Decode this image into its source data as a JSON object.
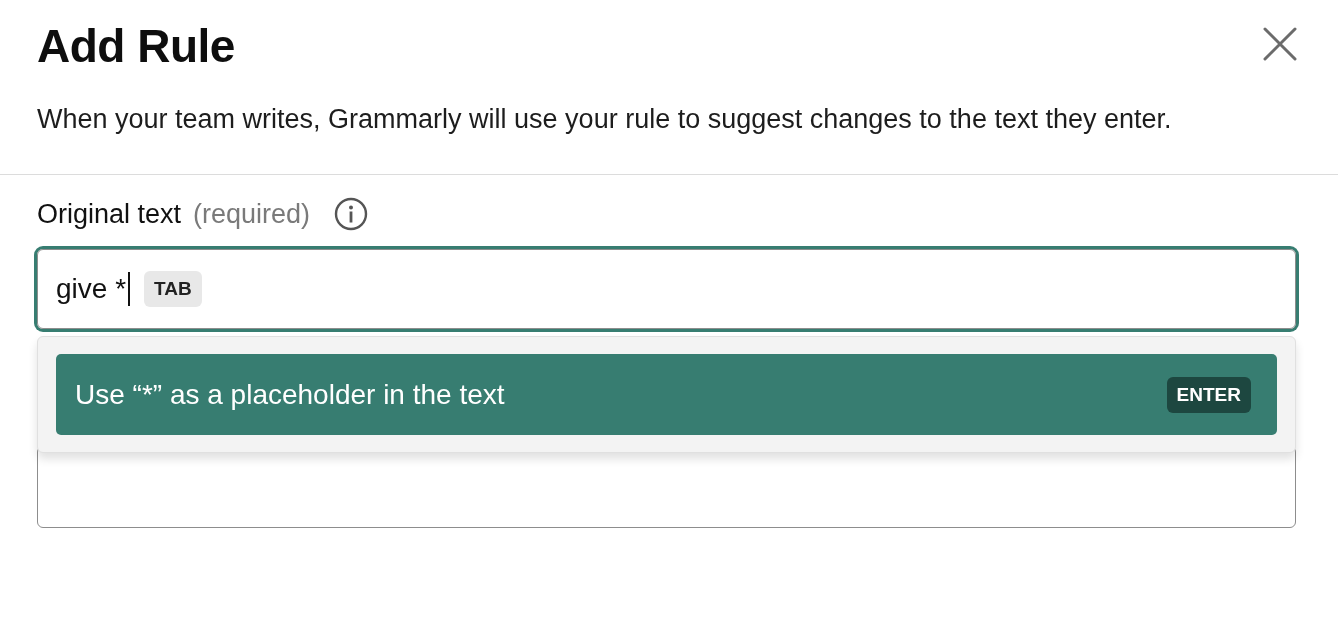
{
  "dialog": {
    "title": "Add Rule",
    "description": "When your team writes, Grammarly will use your rule to suggest changes to the text they enter."
  },
  "field": {
    "label": "Original text",
    "hint": "(required)",
    "value": "give *",
    "focused": true,
    "key_hint": "TAB"
  },
  "suggestions": [
    {
      "text": "Use “*” as a placeholder in the text",
      "key_hint": "ENTER",
      "selected": true
    }
  ]
}
